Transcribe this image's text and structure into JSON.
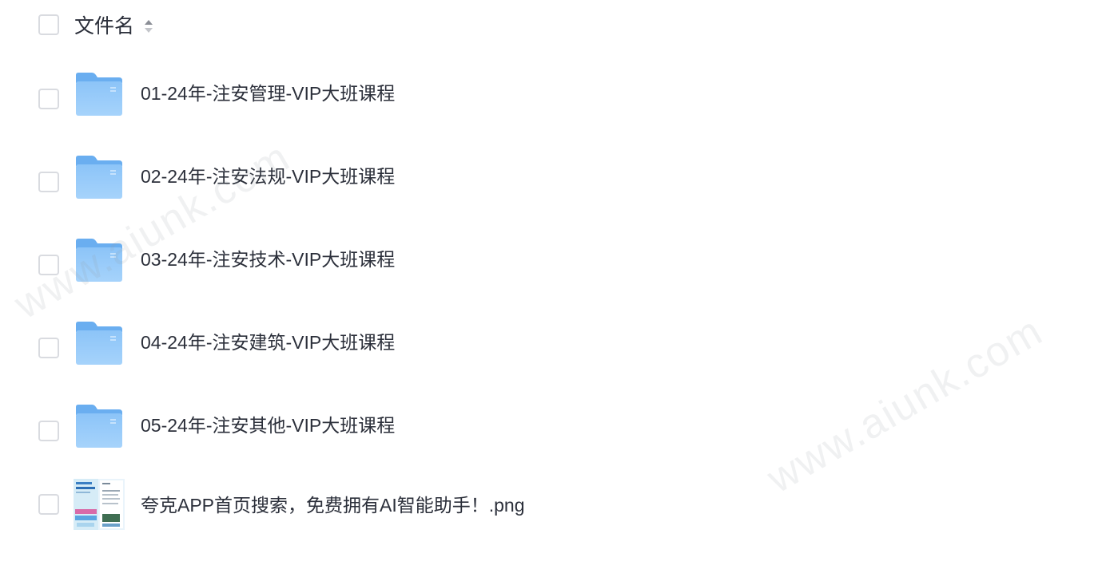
{
  "header": {
    "column_label": "文件名",
    "sort_icon": "sort-updown-icon"
  },
  "files": [
    {
      "name": "01-24年-注安管理-VIP大班课程",
      "type": "folder",
      "icon": "folder-icon"
    },
    {
      "name": "02-24年-注安法规-VIP大班课程",
      "type": "folder",
      "icon": "folder-icon"
    },
    {
      "name": "03-24年-注安技术-VIP大班课程",
      "type": "folder",
      "icon": "folder-icon"
    },
    {
      "name": "04-24年-注安建筑-VIP大班课程",
      "type": "folder",
      "icon": "folder-icon"
    },
    {
      "name": "05-24年-注安其他-VIP大班课程",
      "type": "folder",
      "icon": "folder-icon"
    },
    {
      "name": "夸克APP首页搜索，免费拥有AI智能助手！.png",
      "type": "image",
      "icon": "image-thumbnail"
    }
  ],
  "watermark": {
    "text_1": "www.aiunk.com",
    "text_2": "www.aiunk.com"
  },
  "colors": {
    "folder": "#7ab8f5",
    "text": "#2b2f3a",
    "checkbox_border": "#d9dbe0"
  }
}
